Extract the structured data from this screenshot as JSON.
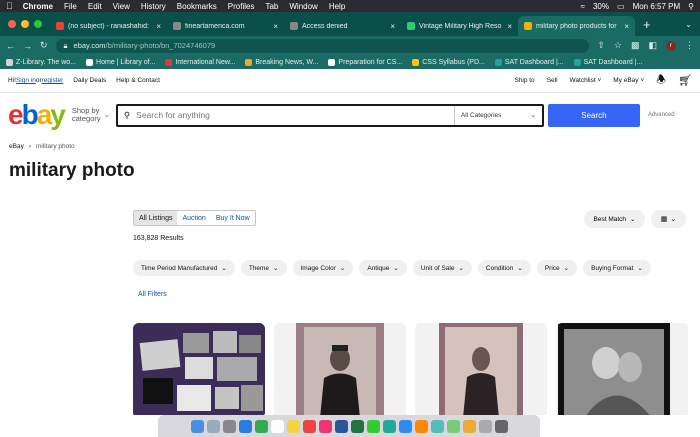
{
  "menubar": {
    "app": "Chrome",
    "items": [
      "File",
      "Edit",
      "View",
      "History",
      "Bookmarks",
      "Profiles",
      "Tab",
      "Window",
      "Help"
    ],
    "battery": "30%",
    "clock": "Mon 6:57 PM"
  },
  "tabs": [
    {
      "title": "(no subject) - raniashahid:",
      "color": "#ea4335"
    },
    {
      "title": "fineartamerica.com",
      "color": "#888888"
    },
    {
      "title": "Access denied",
      "color": "#888888"
    },
    {
      "title": "Vintage Military High Reso",
      "color": "#2ecc71"
    },
    {
      "title": "military photo products for",
      "color": "#f5af02"
    }
  ],
  "address": {
    "url_host": "ebay.com",
    "url_path": "/b/military-photo/bn_7024746079",
    "avatar_letter": "r"
  },
  "bookmarks": [
    {
      "label": "Z-Library. The wo...",
      "color": "#d4d4d4"
    },
    {
      "label": "Home | Library of...",
      "color": "#ffffff"
    },
    {
      "label": "International New...",
      "color": "#e33"
    },
    {
      "label": "Breaking News, W...",
      "color": "#f5a623"
    },
    {
      "label": "Preparation for CS...",
      "color": "#ffffff"
    },
    {
      "label": "CSS Syllabus (PD...",
      "color": "#f5c518"
    },
    {
      "label": "SAT Dashboard |...",
      "color": "#2aa198"
    },
    {
      "label": "SAT Dashboard |...",
      "color": "#2aa198"
    }
  ],
  "ebay": {
    "greeting_prefix": "Hi! ",
    "sign_in": "Sign in",
    "or": " or ",
    "register": "register",
    "daily_deals": "Daily Deals",
    "help": "Help & Contact",
    "ship_to": "Ship to",
    "sell": "Sell",
    "watchlist": "Watchlist",
    "my_ebay": "My eBay",
    "shop_by_1": "Shop by",
    "shop_by_2": "category",
    "search_placeholder": "Search for anything",
    "categories": "All Categories",
    "search_btn": "Search",
    "advanced": "Advanced",
    "crumb_root": "eBay",
    "crumb_current": "military photo",
    "page_title": "military photo",
    "listing_tabs": [
      "All Listings",
      "Auction",
      "Buy It Now"
    ],
    "results": "163,828 Results",
    "sort": "Best Match",
    "filters": [
      "Time Period Manufactured",
      "Theme",
      "Image Color",
      "Antique",
      "Unit of Sale",
      "Condition",
      "Price",
      "Buying Format"
    ],
    "all_filters": "All Filters"
  }
}
